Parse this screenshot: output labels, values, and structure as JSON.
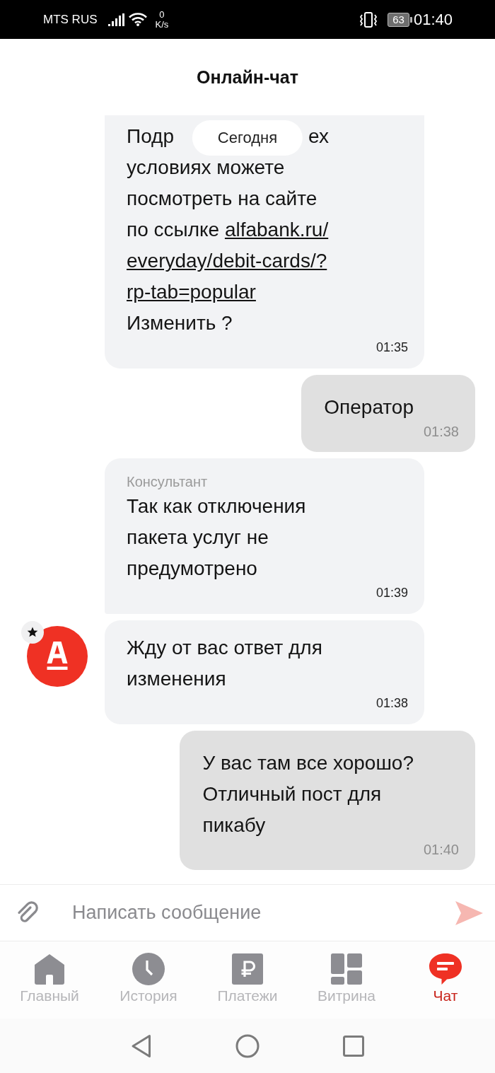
{
  "status_bar": {
    "carrier": "MTS RUS",
    "speed_value": "0",
    "speed_unit": "K/s",
    "battery": "63",
    "time": "01:40"
  },
  "header": {
    "title": "Онлайн-чат"
  },
  "chat": {
    "date_label": "Сегодня",
    "messages": [
      {
        "kind": "incoming",
        "covered_line": {
          "left": "Подр",
          "right": "ех"
        },
        "text": "условиях можете\nпосмотреть на сайте\nпо ссылке",
        "link_lines": [
          "alfabank.ru/",
          "everyday/debit-cards/?",
          "rp-tab=popular"
        ],
        "text_after": "Изменить ?",
        "time": "01:35"
      },
      {
        "kind": "outgoing",
        "text": "Оператор",
        "time": "01:38"
      },
      {
        "kind": "incoming",
        "sender": "Консультант",
        "text": "Так как отключения\nпакета услуг не\nпредумотрено",
        "time": "01:39"
      },
      {
        "kind": "incoming",
        "avatar": true,
        "text": "Жду от вас ответ для\nизменения",
        "time": "01:38"
      },
      {
        "kind": "outgoing",
        "text": "У вас там все хорошо?\nОтличный пост для\nпикабу",
        "time": "01:40"
      }
    ]
  },
  "composer": {
    "placeholder": "Написать сообщение"
  },
  "tab_bar": {
    "items": [
      {
        "label": "Главный",
        "selected": false
      },
      {
        "label": "История",
        "selected": false
      },
      {
        "label": "Платежи",
        "selected": false
      },
      {
        "label": "Витрина",
        "selected": false
      },
      {
        "label": "Чат",
        "selected": true
      }
    ]
  }
}
